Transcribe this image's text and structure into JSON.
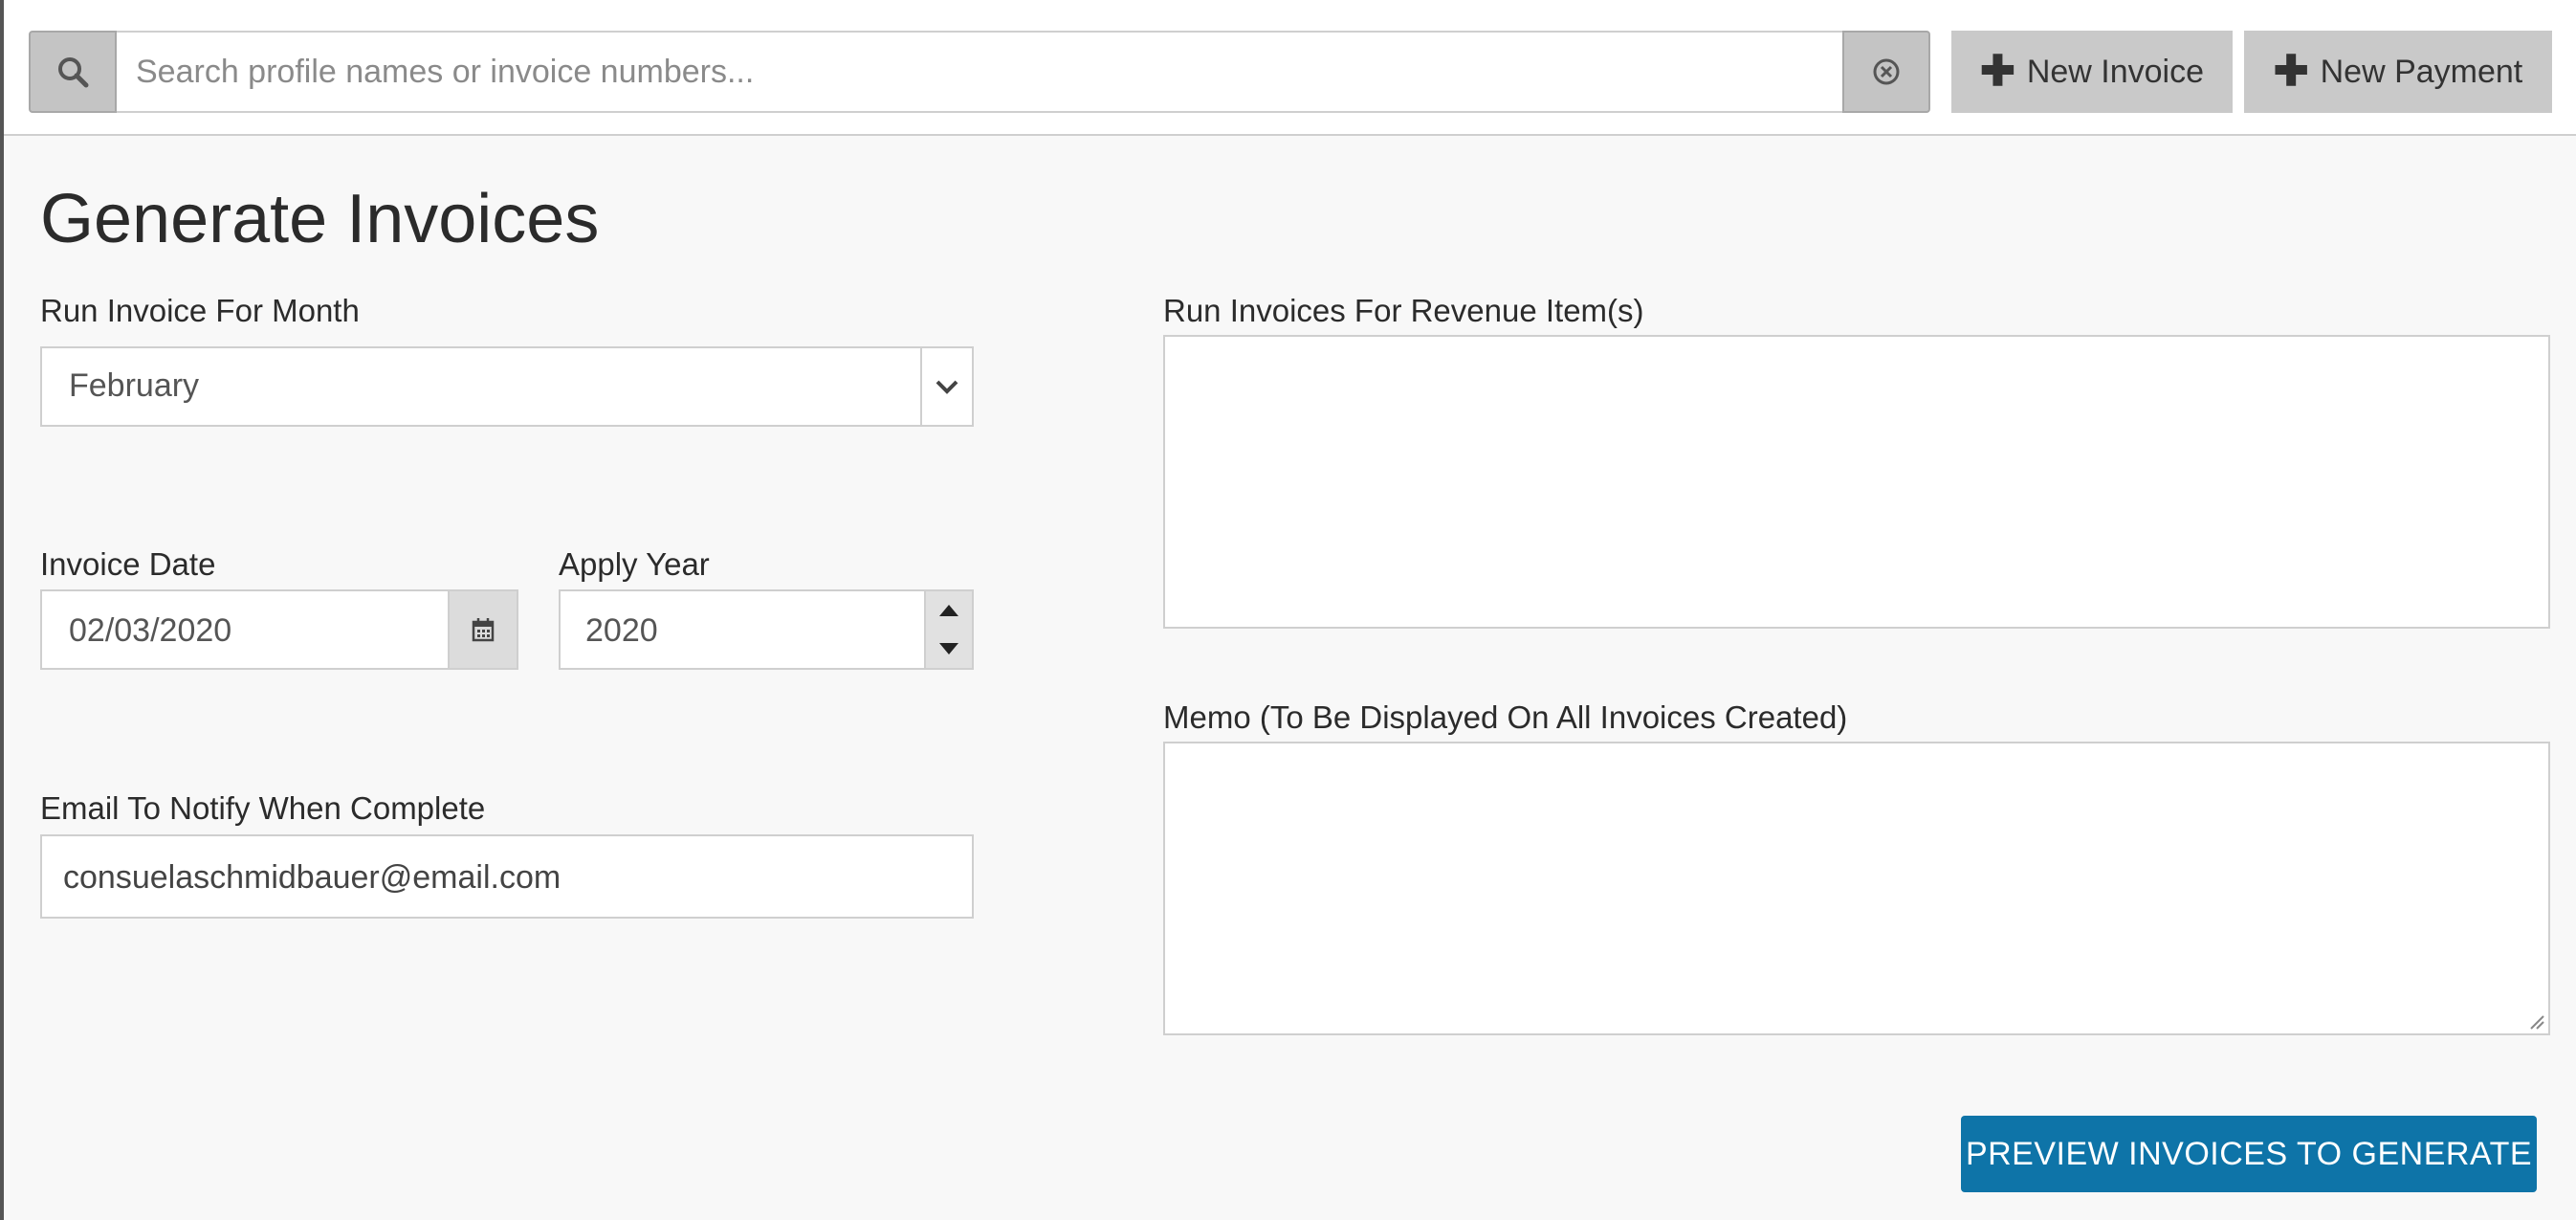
{
  "topbar": {
    "search": {
      "placeholder": "Search profile names or invoice numbers...",
      "value": "",
      "search_icon": "search-icon",
      "clear_icon": "clear-circle-icon"
    },
    "new_invoice_label": "New Invoice",
    "new_payment_label": "New Payment",
    "plus_icon": "plus-icon"
  },
  "page": {
    "title": "Generate Invoices"
  },
  "form": {
    "month": {
      "label": "Run Invoice For Month",
      "selected": "February",
      "caret_icon": "chevron-down-icon"
    },
    "invoice_date": {
      "label": "Invoice Date",
      "value": "02/03/2020",
      "icon": "calendar-icon"
    },
    "apply_year": {
      "label": "Apply Year",
      "value": "2020",
      "up_icon": "triangle-up-icon",
      "down_icon": "triangle-down-icon"
    },
    "email": {
      "label": "Email To Notify When Complete",
      "value": "consuelaschmidbauer@email.com"
    },
    "revenue_items": {
      "label": "Run Invoices For Revenue Item(s)",
      "value": ""
    },
    "memo": {
      "label": "Memo (To Be Displayed On All Invoices Created)",
      "value": ""
    },
    "preview_button_label": "PREVIEW INVOICES TO GENERATE"
  },
  "colors": {
    "primary_button": "#0e74a8",
    "toolbar_button": "#c9c9c9",
    "page_background": "#f8f8f8"
  }
}
